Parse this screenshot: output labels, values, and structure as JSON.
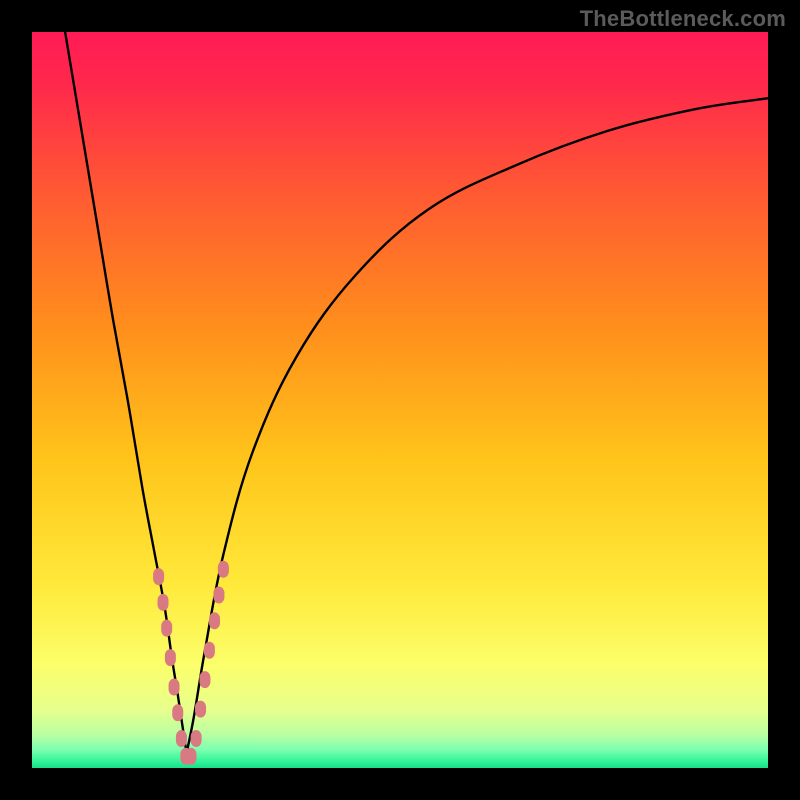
{
  "watermark": "TheBottleneck.com",
  "chart_data": {
    "type": "line",
    "title": "",
    "xlabel": "",
    "ylabel": "",
    "xlim": [
      0,
      100
    ],
    "ylim": [
      0,
      100
    ],
    "grid": false,
    "legend": false,
    "background_gradient": {
      "description": "Vertical gradient from red at top through orange/yellow to thin green band at bottom",
      "stops": [
        {
          "pos": 0.0,
          "color": "#ff1b55"
        },
        {
          "pos": 0.08,
          "color": "#ff2b4a"
        },
        {
          "pos": 0.22,
          "color": "#ff5a32"
        },
        {
          "pos": 0.4,
          "color": "#ff8e1c"
        },
        {
          "pos": 0.58,
          "color": "#ffc41a"
        },
        {
          "pos": 0.75,
          "color": "#ffe93a"
        },
        {
          "pos": 0.86,
          "color": "#fbff6a"
        },
        {
          "pos": 0.92,
          "color": "#e8ff8c"
        },
        {
          "pos": 0.955,
          "color": "#b8ffa2"
        },
        {
          "pos": 0.975,
          "color": "#7dffb0"
        },
        {
          "pos": 0.99,
          "color": "#35f59a"
        },
        {
          "pos": 1.0,
          "color": "#18e08a"
        }
      ]
    },
    "series": [
      {
        "name": "left_branch",
        "description": "Steep descending branch from top-left to valley",
        "x": [
          4.5,
          7,
          9,
          11,
          13,
          15,
          16.5,
          18,
          19,
          19.8,
          20.4,
          21
        ],
        "y": [
          100,
          85,
          73,
          61,
          50,
          38,
          30,
          22,
          15,
          10,
          6,
          2
        ]
      },
      {
        "name": "right_branch",
        "description": "Ascending branch from valley sweeping to upper-right",
        "x": [
          21,
          22,
          23.5,
          26,
          30,
          36,
          44,
          54,
          66,
          78,
          90,
          100
        ],
        "y": [
          2,
          7,
          16,
          29,
          43,
          56,
          67,
          76,
          82,
          86.5,
          89.5,
          91
        ]
      }
    ],
    "valley_x": 21,
    "valley_y": 0.5,
    "scatter": {
      "name": "highlighted_points",
      "description": "Pink rounded markers clustered around the valley on both branches",
      "color": "#d97a83",
      "points": [
        {
          "x": 17.2,
          "y": 26
        },
        {
          "x": 17.8,
          "y": 22.5
        },
        {
          "x": 18.3,
          "y": 19
        },
        {
          "x": 18.8,
          "y": 15
        },
        {
          "x": 19.3,
          "y": 11
        },
        {
          "x": 19.8,
          "y": 7.5
        },
        {
          "x": 20.3,
          "y": 4
        },
        {
          "x": 20.9,
          "y": 1.6
        },
        {
          "x": 21.6,
          "y": 1.6
        },
        {
          "x": 22.3,
          "y": 4
        },
        {
          "x": 22.9,
          "y": 8
        },
        {
          "x": 23.5,
          "y": 12
        },
        {
          "x": 24.1,
          "y": 16
        },
        {
          "x": 24.8,
          "y": 20
        },
        {
          "x": 25.4,
          "y": 23.5
        },
        {
          "x": 26.0,
          "y": 27
        }
      ]
    }
  }
}
